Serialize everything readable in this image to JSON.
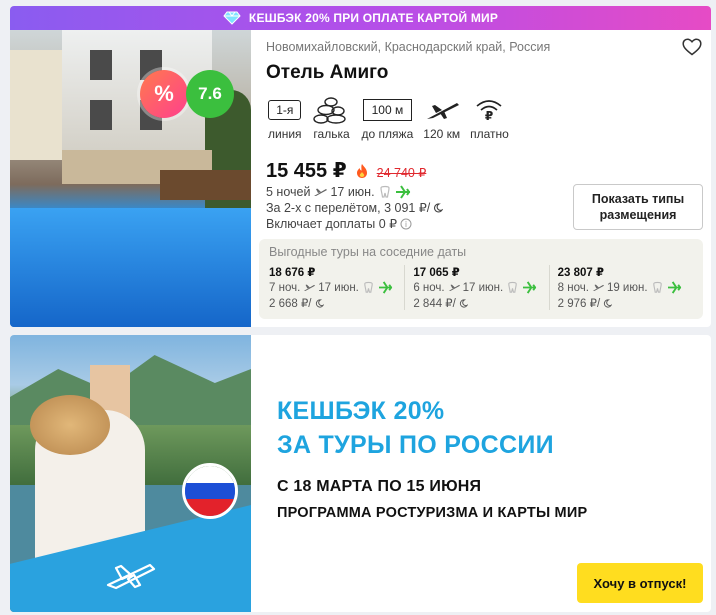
{
  "banner": {
    "text": "КЕШБЭК 20% ПРИ ОПЛАТЕ КАРТОЙ МИР",
    "icon": "diamond-icon"
  },
  "hotel": {
    "discount_badge": "%",
    "rating": "7.6",
    "location": "Новомихайловский, Краснодарский край, Россия",
    "name": "Отель Амиго",
    "favorite_icon": "heart-icon",
    "amenities": [
      {
        "badge": "1-я",
        "label": "линия",
        "icon": "line-badge"
      },
      {
        "badge": "",
        "label": "галька",
        "icon": "pebbles-icon"
      },
      {
        "badge": "100 м",
        "label": "до пляжа",
        "icon": "distance-sign"
      },
      {
        "badge": "",
        "label": "120 км",
        "icon": "airplane-icon"
      },
      {
        "badge": "₽",
        "label": "платно",
        "icon": "wifi-paid-icon"
      }
    ],
    "price": "15 455 ₽",
    "old_price": "24 740 ₽",
    "nights_line": "5 ночей",
    "date": "17 июн.",
    "flight_line": "За 2-х с перелётом, 3 091 ₽/",
    "fees_line": "Включает доплаты 0 ₽",
    "show_types_button": "Показать типы размещения"
  },
  "nearby": {
    "title": "Выгодные туры на соседние даты",
    "tours": [
      {
        "price": "18 676 ₽",
        "nights": "7 ноч.",
        "date": "17 июн.",
        "per_night": "2 668 ₽/"
      },
      {
        "price": "17 065 ₽",
        "nights": "6 ноч.",
        "date": "17 июн.",
        "per_night": "2 844 ₽/"
      },
      {
        "price": "23 807 ₽",
        "nights": "8 ноч.",
        "date": "19 июн.",
        "per_night": "2 976 ₽/"
      }
    ]
  },
  "promo": {
    "headline_line1": "КЕШБЭК 20%",
    "headline_line2": "ЗА ТУРЫ ПО РОССИИ",
    "sub_line1": "С 18 МАРТА ПО 15 ИЮНЯ",
    "sub_line2": "ПРОГРАММА РОСТУРИЗМА И КАРТЫ МИР",
    "cta": "Хочу в отпуск!",
    "accent_color": "#1ea4df",
    "cta_color": "#ffdd1f"
  },
  "colors": {
    "rating_green": "#3bbf3e",
    "old_price_red": "#e0282e",
    "banner_start": "#8a5cf0",
    "banner_end": "#e64bc5"
  }
}
